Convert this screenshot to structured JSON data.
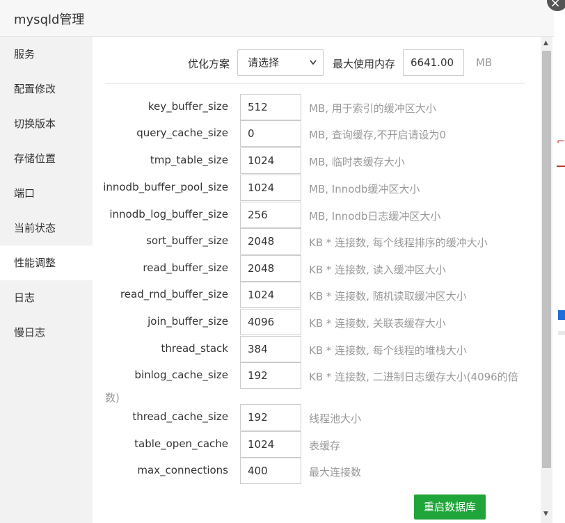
{
  "dialog": {
    "title": "mysqld管理",
    "close_glyph": "×"
  },
  "sidebar": {
    "items": [
      {
        "label": "服务"
      },
      {
        "label": "配置修改"
      },
      {
        "label": "切换版本"
      },
      {
        "label": "存储位置"
      },
      {
        "label": "端口"
      },
      {
        "label": "当前状态"
      },
      {
        "label": "性能调整",
        "active": true
      },
      {
        "label": "日志"
      },
      {
        "label": "慢日志"
      }
    ]
  },
  "tuning": {
    "plan_label": "优化方案",
    "plan_selected": "请选择",
    "max_mem_label": "最大使用内存",
    "max_mem_value": "6641.00",
    "max_mem_unit": "MB",
    "rows": [
      {
        "name": "key_buffer_size",
        "value": "512",
        "hint": "MB, 用于索引的缓冲区大小"
      },
      {
        "name": "query_cache_size",
        "value": "0",
        "hint": "MB, 查询缓存,不开启请设为0"
      },
      {
        "name": "tmp_table_size",
        "value": "1024",
        "hint": "MB, 临时表缓存大小"
      },
      {
        "name": "innodb_buffer_pool_size",
        "value": "1024",
        "hint": "MB, Innodb缓冲区大小"
      },
      {
        "name": "innodb_log_buffer_size",
        "value": "256",
        "hint": "MB, Innodb日志缓冲区大小"
      },
      {
        "name": "sort_buffer_size",
        "value": "2048",
        "hint": "KB * 连接数, 每个线程排序的缓冲大小"
      },
      {
        "name": "read_buffer_size",
        "value": "2048",
        "hint": "KB * 连接数, 读入缓冲区大小"
      },
      {
        "name": "read_rnd_buffer_size",
        "value": "1024",
        "hint": "KB * 连接数, 随机读取缓冲区大小"
      },
      {
        "name": "join_buffer_size",
        "value": "4096",
        "hint": "KB * 连接数, 关联表缓存大小"
      },
      {
        "name": "thread_stack",
        "value": "384",
        "hint": "KB * 连接数, 每个线程的堆栈大小"
      },
      {
        "name": "binlog_cache_size",
        "value": "192",
        "hint": "KB * 连接数, 二进制日志缓存大小(4096的倍",
        "hint_tail": "数)"
      },
      {
        "name": "thread_cache_size",
        "value": "192",
        "hint": "线程池大小"
      },
      {
        "name": "table_open_cache",
        "value": "1024",
        "hint": "表缓存"
      },
      {
        "name": "max_connections",
        "value": "400",
        "hint": "最大连接数"
      }
    ],
    "restart_label": "重启数据库"
  },
  "icons": {
    "select_chevron": "chevron-down-icon",
    "close": "close-icon"
  },
  "colors": {
    "primary_button": "#20a53a",
    "sidebar_bg": "#f2f2f2",
    "hint_text": "#999999"
  }
}
